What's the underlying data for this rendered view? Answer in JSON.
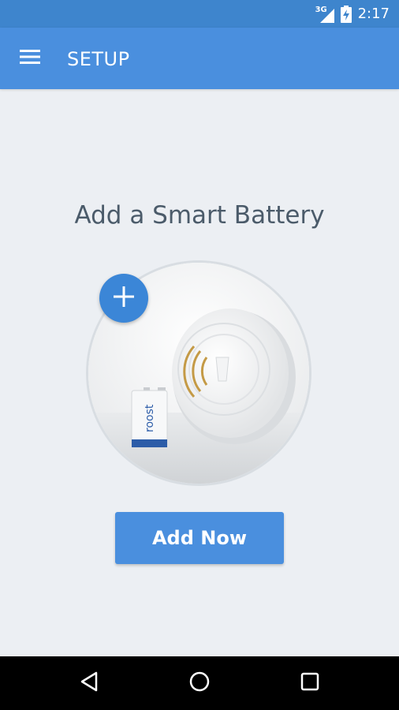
{
  "status_bar": {
    "network_type": "3G",
    "time": "2:17",
    "icons": [
      "signal-icon",
      "battery-charging-icon"
    ]
  },
  "app_bar": {
    "title": "SETUP",
    "menu_icon": "hamburger-menu-icon"
  },
  "main": {
    "headline": "Add a Smart Battery",
    "fab_icon": "plus-icon",
    "battery_brand": "roost",
    "add_button_label": "Add Now"
  },
  "nav_bar": {
    "icons": [
      "back-icon",
      "home-icon",
      "recents-icon"
    ]
  },
  "colors": {
    "status_bar": "#3e85cd",
    "app_bar": "#4a8fde",
    "background": "#eceff3",
    "headline_text": "#4b5b6a",
    "accent": "#3b86d7"
  }
}
